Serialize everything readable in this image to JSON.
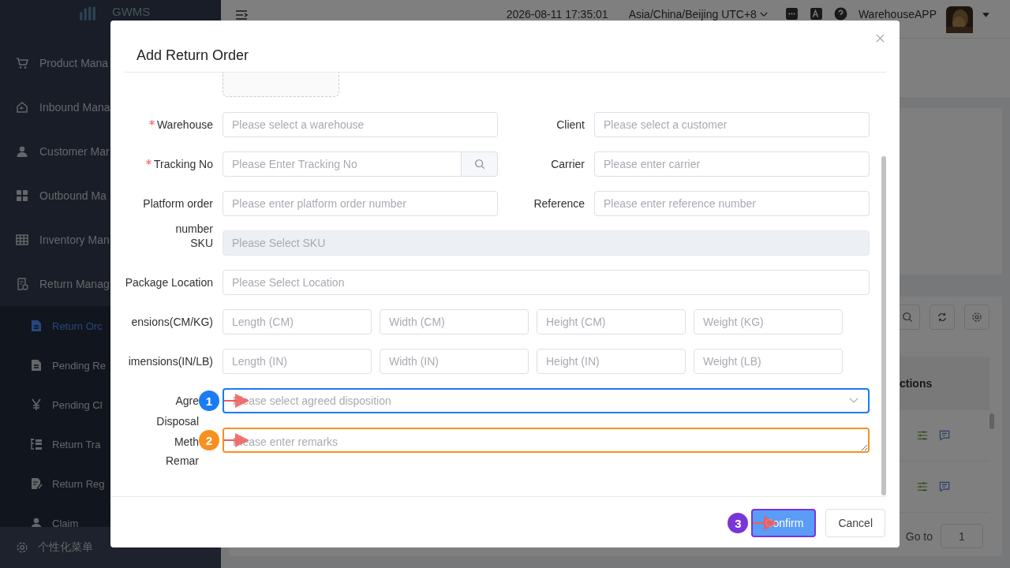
{
  "sidebar": {
    "logo": "GWMS",
    "items": [
      {
        "label": "Product Mana",
        "kind": "cart"
      },
      {
        "label": "Inbound Mana",
        "kind": "home"
      },
      {
        "label": "Customer Mar",
        "kind": "user"
      },
      {
        "label": "Outbound Ma",
        "kind": "grid4"
      },
      {
        "label": "Inventory Man",
        "kind": "grid9"
      },
      {
        "label": "Return Manag",
        "kind": "docs"
      }
    ],
    "sub_items": [
      {
        "label": "Return Orc",
        "kind": "doc",
        "selected": true
      },
      {
        "label": "Pending Re",
        "kind": "doc",
        "selected": false
      },
      {
        "label": "Pending Cl",
        "kind": "yen",
        "selected": false
      },
      {
        "label": "Return Tra",
        "kind": "tree",
        "selected": false
      },
      {
        "label": "Return Reg",
        "kind": "docedit",
        "selected": false
      },
      {
        "label": "Claim",
        "kind": "user",
        "selected": false
      }
    ],
    "footer": "个性化菜单"
  },
  "topbar": {
    "datetime": "2026-08-11 17:35:01",
    "timezone": "Asia/China/Beijing UTC+8",
    "user": "WarehouseAPP"
  },
  "background": {
    "table_header": "ctions",
    "pagination": {
      "label": "Go to",
      "value": "1"
    }
  },
  "dialog": {
    "title": "Add Return Order",
    "rows": [
      {
        "kind": "pair",
        "fields": [
          {
            "label": "Warehouse",
            "required": true,
            "kind": "input",
            "placeholder": "Please select a warehouse"
          },
          {
            "label": "Client",
            "kind": "input",
            "placeholder": "Please select a customer"
          }
        ]
      },
      {
        "kind": "pair",
        "fields": [
          {
            "label": "Tracking No",
            "required": true,
            "kind": "search",
            "placeholder": "Please Enter Tracking No"
          },
          {
            "label": "Carrier",
            "kind": "input",
            "placeholder": "Please enter carrier"
          }
        ]
      },
      {
        "kind": "pair",
        "fields": [
          {
            "label": "Platform order number",
            "kind": "input",
            "placeholder": "Please enter platform order number"
          },
          {
            "label": "Reference",
            "kind": "input",
            "placeholder": "Please enter reference number"
          }
        ]
      },
      {
        "kind": "full",
        "fields": [
          {
            "label": "SKU",
            "kind": "input",
            "disabled": true,
            "placeholder": "Please Select SKU"
          }
        ]
      },
      {
        "kind": "full",
        "fields": [
          {
            "label": "Package Location",
            "kind": "input",
            "placeholder": "Please Select Location"
          }
        ]
      },
      {
        "kind": "quad",
        "label": "ensions(CM/KG)",
        "placeholders": [
          "Length (CM)",
          "Width (CM)",
          "Height (CM)",
          "Weight (KG)"
        ]
      },
      {
        "kind": "quad",
        "label": "imensions(IN/LB)",
        "placeholders": [
          "Length (IN)",
          "Width (IN)",
          "Height (IN)",
          "Weight (LB)"
        ]
      },
      {
        "kind": "full",
        "fields": [
          {
            "label": "Agre\nDisposal\nMeth",
            "kind": "select",
            "placeholder": "Please select agreed disposition",
            "color": "#1a7cf5",
            "annotation": "1"
          }
        ]
      },
      {
        "kind": "full",
        "fields": [
          {
            "label": "Remar",
            "kind": "textarea",
            "placeholder": "Please enter remarks",
            "color": "#f7901e",
            "annotation": "2"
          }
        ]
      }
    ],
    "buttons": [
      {
        "label": "Confirm",
        "kind": "primary",
        "color": "#7a35d8",
        "annotation": "3"
      },
      {
        "label": "Cancel",
        "kind": "default"
      }
    ]
  }
}
